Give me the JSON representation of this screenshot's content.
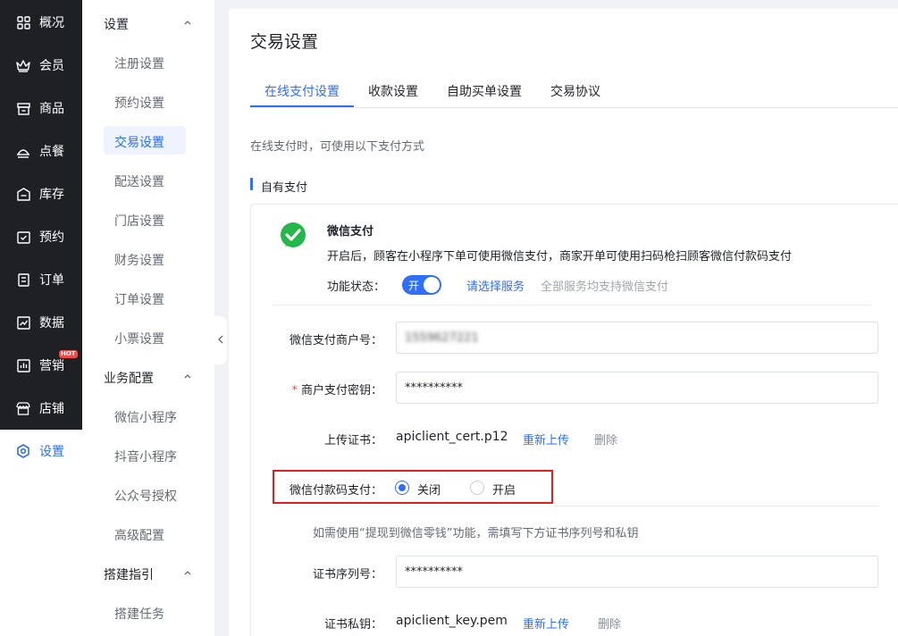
{
  "nav": {
    "items": [
      {
        "label": "概况",
        "icon": "dashboard-icon"
      },
      {
        "label": "会员",
        "icon": "crown-icon"
      },
      {
        "label": "商品",
        "icon": "store-icon"
      },
      {
        "label": "点餐",
        "icon": "dish-icon"
      },
      {
        "label": "库存",
        "icon": "warehouse-icon"
      },
      {
        "label": "预约",
        "icon": "calendar-check-icon"
      },
      {
        "label": "订单",
        "icon": "order-icon"
      },
      {
        "label": "数据",
        "icon": "chart-icon"
      },
      {
        "label": "营销",
        "icon": "marketing-icon",
        "badge": "HOT"
      },
      {
        "label": "店铺",
        "icon": "shop-icon"
      },
      {
        "label": "设置",
        "icon": "settings-icon",
        "active": true
      }
    ]
  },
  "submenu": {
    "group1": "设置",
    "group1_items": [
      "注册设置",
      "预约设置",
      "交易设置",
      "配送设置",
      "门店设置",
      "财务设置",
      "订单设置",
      "小票设置"
    ],
    "group2": "业务配置",
    "group2_items": [
      "微信小程序",
      "抖音小程序",
      "公众号授权",
      "高级配置"
    ],
    "group3": "搭建指引",
    "group3_items": [
      "搭建任务"
    ]
  },
  "page": {
    "title": "交易设置",
    "tabs": [
      "在线支付设置",
      "收款设置",
      "自助买单设置",
      "交易协议"
    ],
    "description": "在线支付时，可使用以下支付方式",
    "section_title": "自有支付"
  },
  "wechat_pay": {
    "title": "微信支付",
    "description": "开启后，顾客在小程序下单可使用微信支付，商家开单可使用扫码枪扫顾客微信付款码支付",
    "status_label": "功能状态：",
    "switch_text": "开",
    "choose_service": "请选择服务",
    "service_note": "全部服务均支持微信支付",
    "merchant_id_label": "微信支付商户号：",
    "merchant_id_value": "1559627221",
    "key_label": "商户支付密钥：",
    "key_required": "*",
    "key_value": "**********",
    "cert_label": "上传证书：",
    "cert_file": "apiclient_cert.p12",
    "reupload": "重新上传",
    "delete": "删除",
    "paycode_label": "微信付款码支付：",
    "paycode_options": [
      "关闭",
      "开启"
    ],
    "paycode_selected": "关闭",
    "change_note": "如需使用“提现到微信零钱”功能，需填写下方证书序列号和私钥",
    "serial_label": "证书序列号：",
    "serial_value": "**********",
    "private_key_label": "证书私钥：",
    "private_key_file": "apiclient_key.pem",
    "reupload2": "重新上传",
    "delete2": "删除"
  },
  "colors": {
    "nav_bg": "#1f2024",
    "accent": "#2f6ef5",
    "wechat_green": "#24b84a",
    "highlight_box": "#e02020"
  }
}
